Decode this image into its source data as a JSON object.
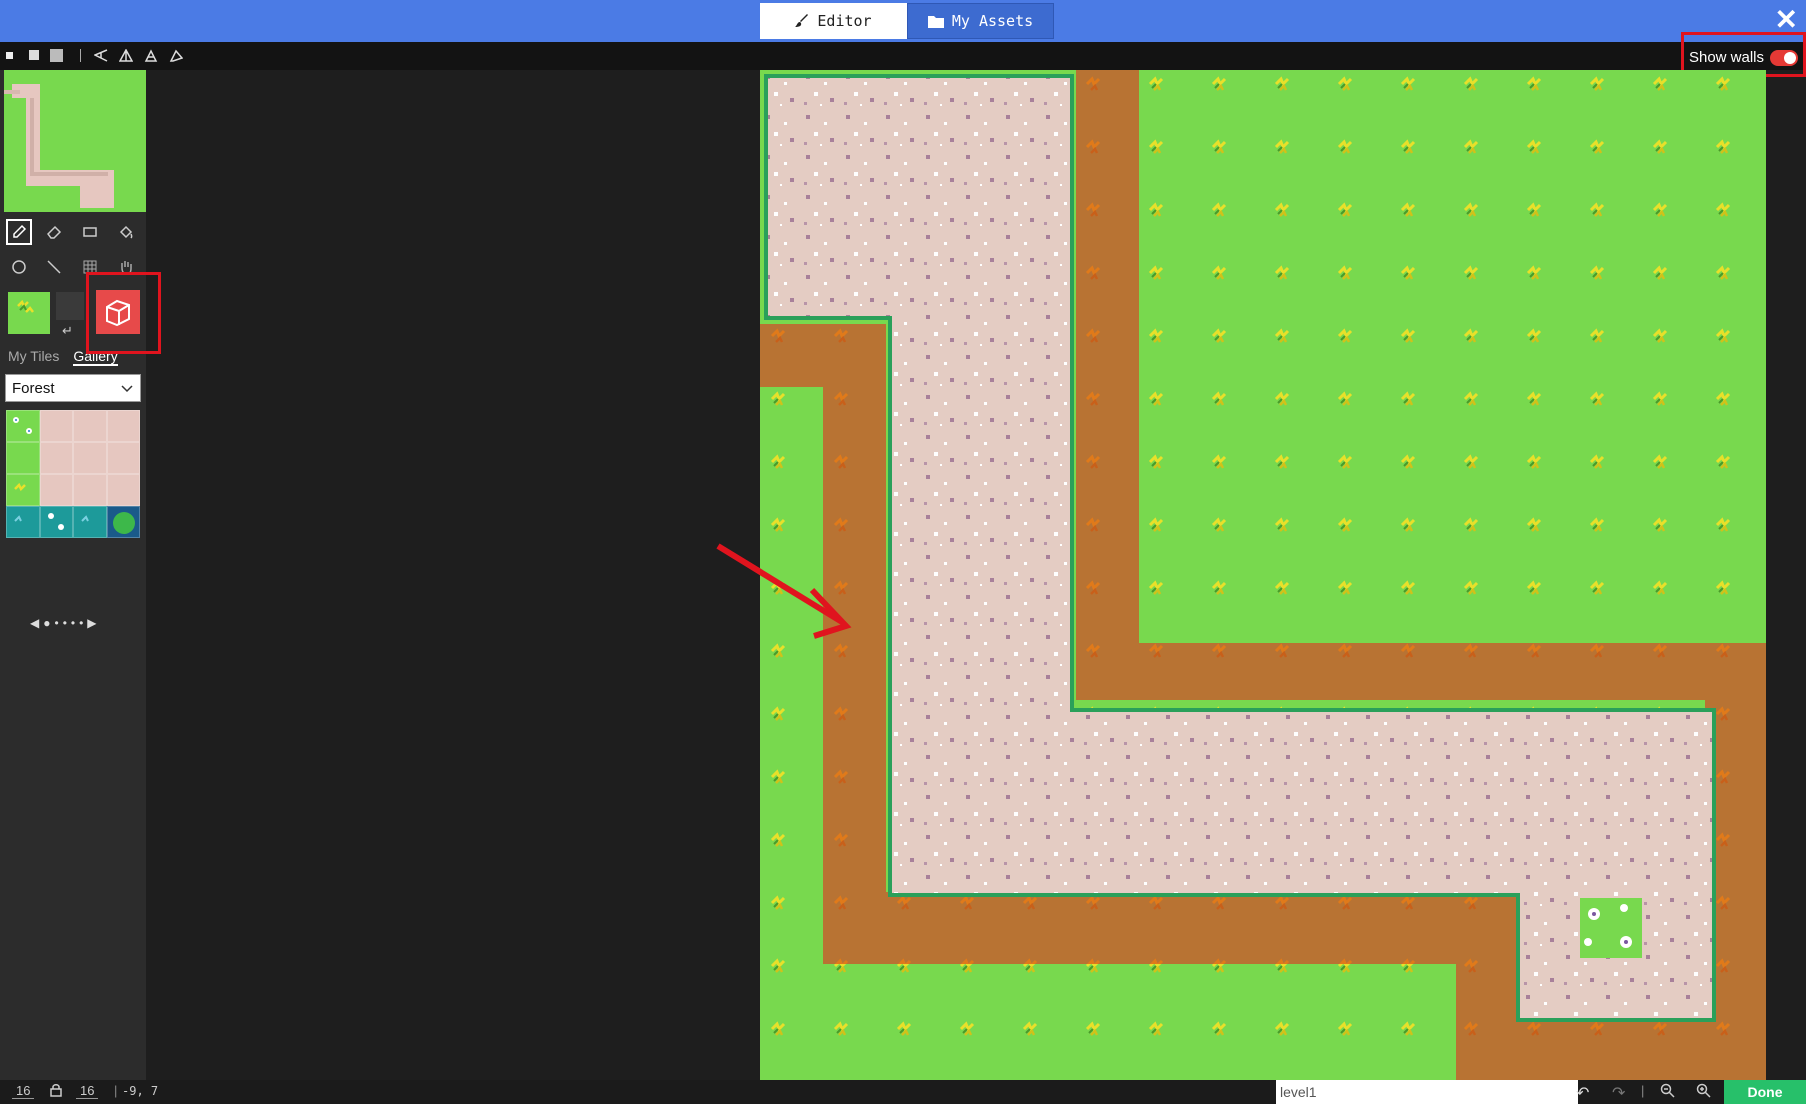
{
  "header": {
    "tabs": [
      {
        "label": "Editor",
        "icon": "brush-icon",
        "active": true
      },
      {
        "label": "My Assets",
        "icon": "folder-icon",
        "active": false
      }
    ],
    "close_icon": "close-icon"
  },
  "toolbar": {
    "items": [
      "small-dot-icon",
      "medium-dot-icon",
      "large-dot-icon",
      "divider",
      "flip-icon",
      "triangle-icon",
      "rotate-icon",
      "shape-icon"
    ],
    "show_walls": {
      "label": "Show walls",
      "enabled": true
    }
  },
  "sidebar": {
    "tools": [
      "pencil-icon",
      "eraser-icon",
      "rectangle-icon",
      "fill-icon",
      "circle-icon",
      "line-icon",
      "grid-icon",
      "hand-icon"
    ],
    "selected_tool": "pencil-icon",
    "wall_icon": "wall-block-icon",
    "tile_tabs": [
      "My Tiles",
      "Gallery"
    ],
    "active_tab": "Gallery",
    "tileset": "Forest",
    "pager_dots": 5
  },
  "status": {
    "tile_width": "16",
    "tile_height": "16",
    "coords": "-9, 7",
    "level_name": "level1",
    "done_label": "Done"
  },
  "colors": {
    "topbar": "#4b7be5",
    "grass": "#78d94e",
    "dirt": "#b87333",
    "path": "#e4ccc3",
    "accent_red": "#e0141e",
    "done": "#27c06a"
  }
}
